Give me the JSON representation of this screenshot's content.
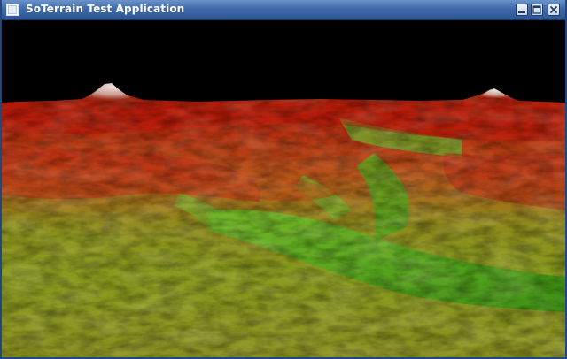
{
  "window": {
    "title": "SoTerrain Test Application",
    "controls": {
      "minimize": "minimize",
      "maximize": "maximize",
      "close": "close"
    }
  },
  "scene": {
    "background_color": "#000000",
    "colors": {
      "sky": "#000000",
      "peak_snow": "#e8dcd8",
      "ridge_red": "#b81a08",
      "mid_orange": "#c66a1a",
      "valley_green": "#3c9a10",
      "plain_olive": "#8a9a18"
    }
  }
}
